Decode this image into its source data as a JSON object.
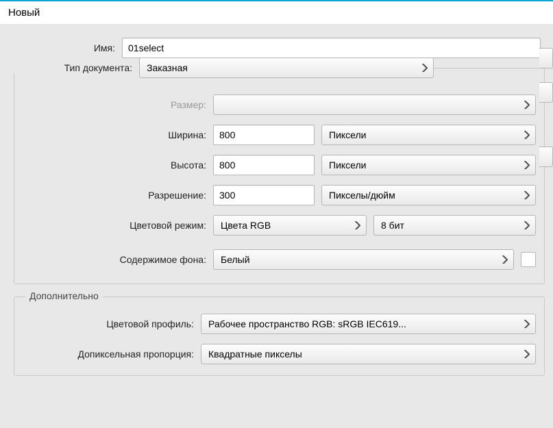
{
  "title": "Новый",
  "name": {
    "label": "Имя:",
    "value": "01select"
  },
  "docType": {
    "label": "Тип документа:",
    "value": "Заказная"
  },
  "size": {
    "label": "Размер:",
    "value": ""
  },
  "width": {
    "label": "Ширина:",
    "value": "800",
    "unit": "Пиксели"
  },
  "height": {
    "label": "Высота:",
    "value": "800",
    "unit": "Пиксели"
  },
  "resolution": {
    "label": "Разрешение:",
    "value": "300",
    "unit": "Пикселы/дюйм"
  },
  "colorMode": {
    "label": "Цветовой режим:",
    "value": "Цвета RGB",
    "depth": "8 бит"
  },
  "background": {
    "label": "Содержимое фона:",
    "value": "Белый"
  },
  "advanced": {
    "legend": "Дополнительно",
    "colorProfile": {
      "label": "Цветовой профиль:",
      "value": "Рабочее пространство RGB:  sRGB IEC619..."
    },
    "pixelAspect": {
      "label": "Допиксельная пропорция:",
      "value": "Квадратные пикселы"
    }
  }
}
